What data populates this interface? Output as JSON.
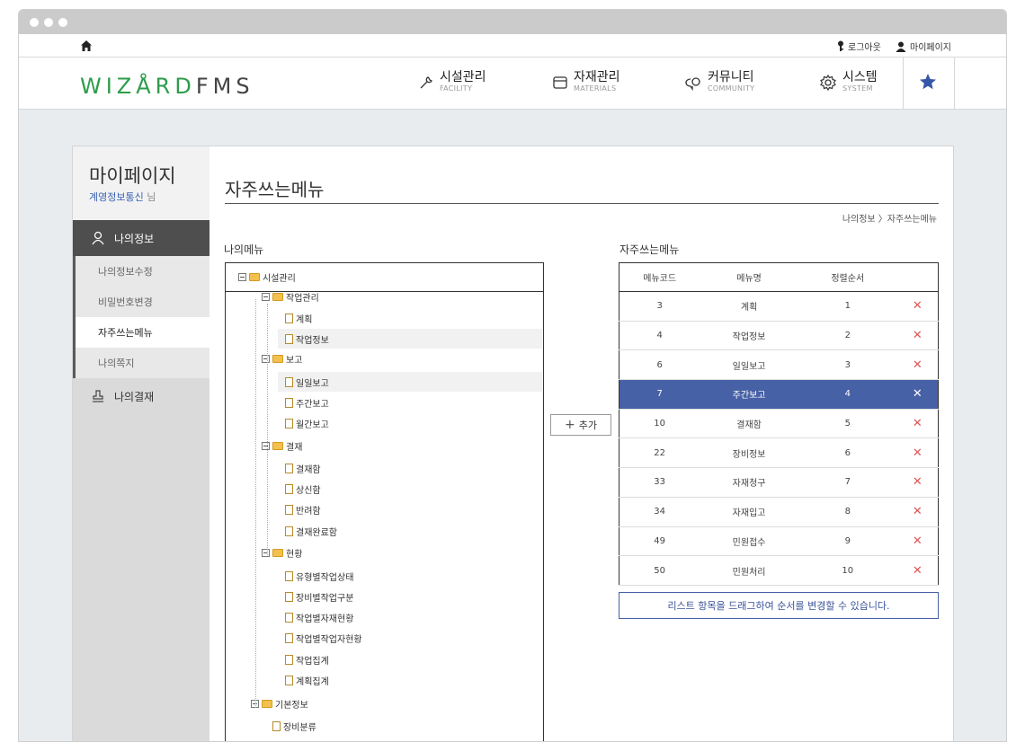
{
  "util": {
    "logout": "로그아웃",
    "mypage": "마이페이지"
  },
  "logo": {
    "part1": "WIZÅRD",
    "part2": "FMS"
  },
  "nav": [
    {
      "ko": "시설관리",
      "en": "FACILITY"
    },
    {
      "ko": "자재관리",
      "en": "MATERIALS"
    },
    {
      "ko": "커뮤니티",
      "en": "COMMUNITY"
    },
    {
      "ko": "시스템",
      "en": "SYSTEM"
    }
  ],
  "sidebar": {
    "title": "마이페이지",
    "user": "계영정보통신",
    "honorific": "님",
    "main1": "나의정보",
    "subs": [
      "나의정보수정",
      "비밀번호변경",
      "자주쓰는메뉴",
      "나의쪽지"
    ],
    "main2": "나의결재"
  },
  "page": {
    "title": "자주쓰는메뉴",
    "breadcrumb": "나의정보 〉자주쓰는메뉴",
    "my_menu_label": "나의메뉴",
    "fav_label": "자주쓰는메뉴",
    "add_label": "추가",
    "hint": "리스트 항목을 드래그하여 순서를 변경할 수 있습니다."
  },
  "tree": {
    "root": "시설관리",
    "nodes": [
      {
        "label": "작업관리",
        "type": "folder"
      },
      {
        "label": "계획",
        "type": "doc"
      },
      {
        "label": "작업정보",
        "type": "doc"
      },
      {
        "label": "보고",
        "type": "folder"
      },
      {
        "label": "일일보고",
        "type": "doc"
      },
      {
        "label": "주간보고",
        "type": "doc"
      },
      {
        "label": "월간보고",
        "type": "doc"
      },
      {
        "label": "결재",
        "type": "folder"
      },
      {
        "label": "결재함",
        "type": "doc"
      },
      {
        "label": "상신함",
        "type": "doc"
      },
      {
        "label": "반려함",
        "type": "doc"
      },
      {
        "label": "결재완료함",
        "type": "doc"
      },
      {
        "label": "현황",
        "type": "folder"
      },
      {
        "label": "유형별작업상태",
        "type": "doc"
      },
      {
        "label": "장비별작업구분",
        "type": "doc"
      },
      {
        "label": "작업별자재현황",
        "type": "doc"
      },
      {
        "label": "작업별작업자현황",
        "type": "doc"
      },
      {
        "label": "작업집계",
        "type": "doc"
      },
      {
        "label": "계획집계",
        "type": "doc"
      },
      {
        "label": "기본정보",
        "type": "folder"
      },
      {
        "label": "장비분류",
        "type": "doc"
      }
    ]
  },
  "fav": {
    "headers": [
      "메뉴코드",
      "메뉴명",
      "정렬순서"
    ],
    "rows": [
      [
        "3",
        "계획",
        "1"
      ],
      [
        "4",
        "작업정보",
        "2"
      ],
      [
        "6",
        "일일보고",
        "3"
      ],
      [
        "7",
        "주간보고",
        "4"
      ],
      [
        "10",
        "결재함",
        "5"
      ],
      [
        "22",
        "장비정보",
        "6"
      ],
      [
        "33",
        "자재청구",
        "7"
      ],
      [
        "34",
        "자재입고",
        "8"
      ],
      [
        "49",
        "민원접수",
        "9"
      ],
      [
        "50",
        "민원처리",
        "10"
      ]
    ],
    "delete_glyph": "✕"
  },
  "colors": {
    "accent": "#4761a6",
    "logo_green": "#2e9c4a",
    "delete": "#e05454"
  }
}
